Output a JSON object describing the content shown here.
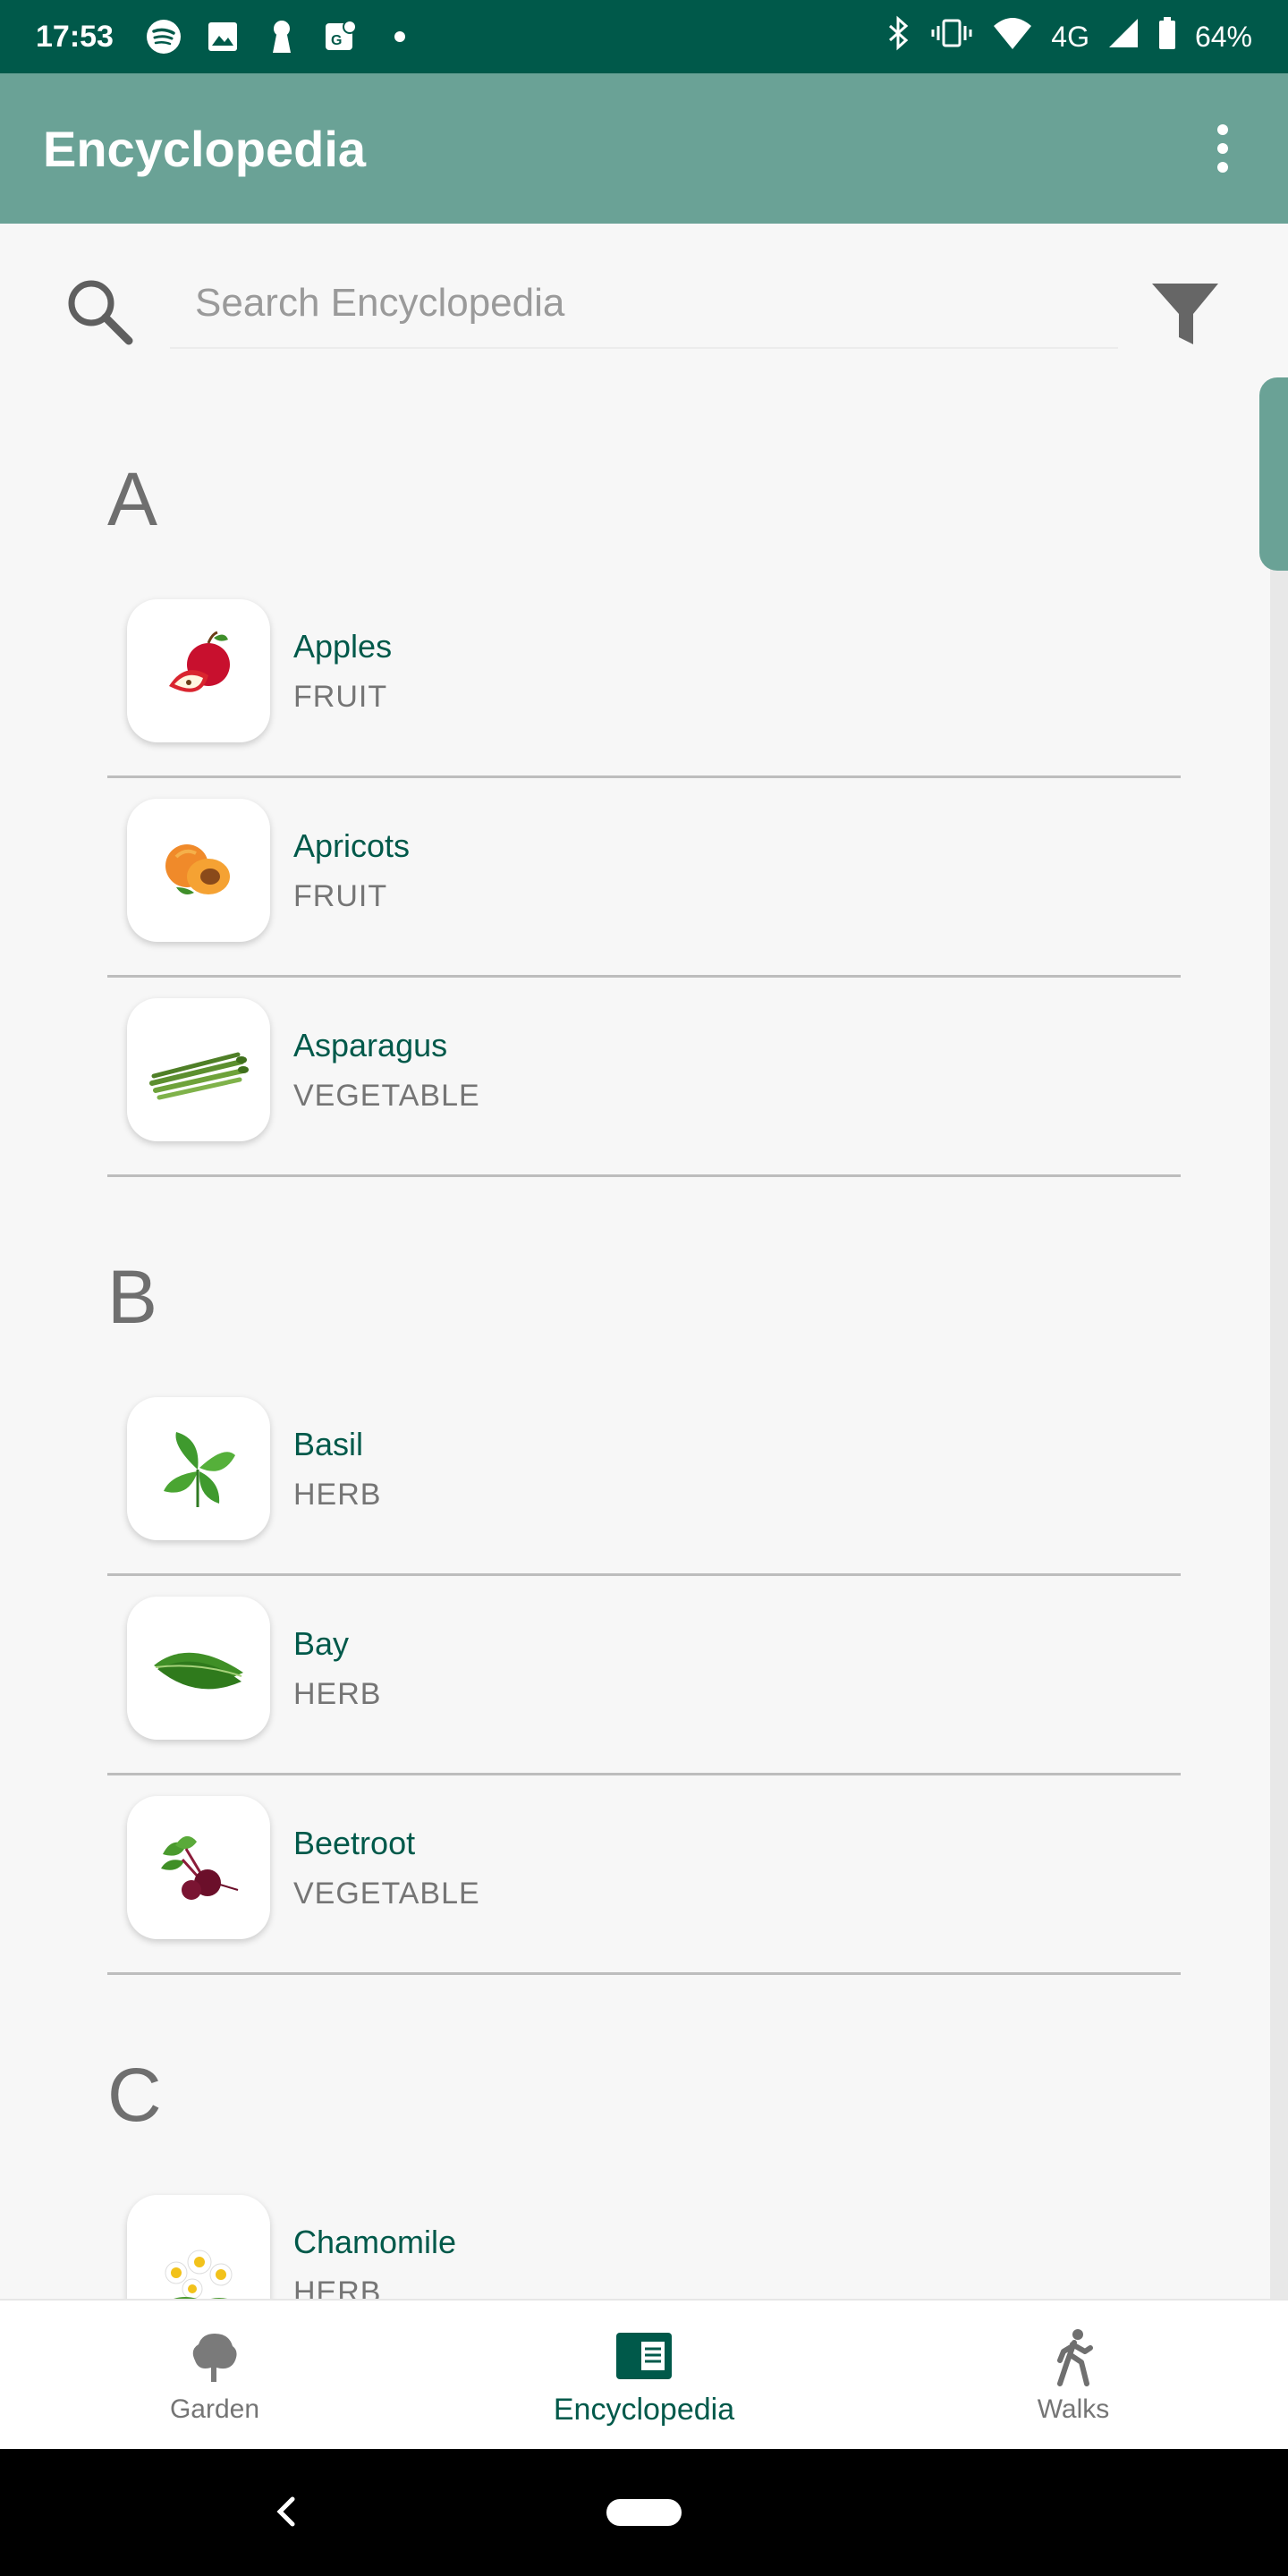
{
  "status_bar": {
    "time": "17:53",
    "network": "4G",
    "battery": "64%",
    "left_icons": [
      "spotify-icon",
      "image-icon",
      "keyhole-icon",
      "maps-icon",
      "dot-icon"
    ],
    "right_icons": [
      "bluetooth-icon",
      "vibrate-icon",
      "wifi-icon",
      "signal-icon",
      "battery-icon"
    ]
  },
  "app_bar": {
    "title": "Encyclopedia",
    "menu_icon": "more-vert-icon"
  },
  "search": {
    "placeholder": "Search Encyclopedia",
    "value": "",
    "search_icon": "search-icon",
    "filter_icon": "filter-icon"
  },
  "sections": [
    {
      "letter": "A",
      "items": [
        {
          "name": "Apples",
          "type": "FRUIT",
          "icon": "apple-icon"
        },
        {
          "name": "Apricots",
          "type": "FRUIT",
          "icon": "apricot-icon"
        },
        {
          "name": "Asparagus",
          "type": "VEGETABLE",
          "icon": "asparagus-icon"
        }
      ]
    },
    {
      "letter": "B",
      "items": [
        {
          "name": "Basil",
          "type": "HERB",
          "icon": "basil-icon"
        },
        {
          "name": "Bay",
          "type": "HERB",
          "icon": "bay-leaf-icon"
        },
        {
          "name": "Beetroot",
          "type": "VEGETABLE",
          "icon": "beetroot-icon"
        }
      ]
    },
    {
      "letter": "C",
      "items": [
        {
          "name": "Chamomile",
          "type": "HERB",
          "icon": "chamomile-icon"
        }
      ]
    }
  ],
  "bottom_nav": {
    "items": [
      {
        "label": "Garden",
        "icon": "tree-icon",
        "active": false
      },
      {
        "label": "Encyclopedia",
        "icon": "book-icon",
        "active": true
      },
      {
        "label": "Walks",
        "icon": "walking-icon",
        "active": false
      }
    ]
  },
  "colors": {
    "status_bar": "#00594a",
    "app_bar": "#6aa296",
    "accent": "#00594a",
    "background": "#f7f7f7"
  }
}
